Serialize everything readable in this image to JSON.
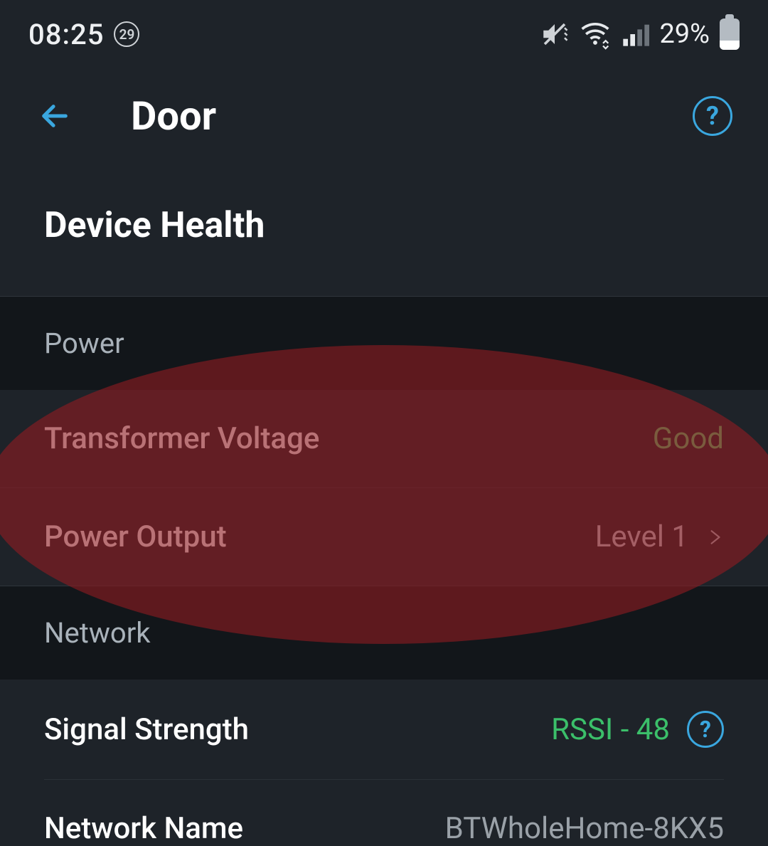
{
  "status_bar": {
    "time": "08:25",
    "notification_count": "29",
    "battery_pct": "29%",
    "battery_level_pct": 29
  },
  "app_bar": {
    "title": "Door",
    "help_icon": "?"
  },
  "page": {
    "heading": "Device Health"
  },
  "sections": {
    "power": {
      "header": "Power",
      "rows": {
        "transformer_voltage": {
          "label": "Transformer Voltage",
          "value": "Good"
        },
        "power_output": {
          "label": "Power Output",
          "value": "Level 1"
        }
      }
    },
    "network": {
      "header": "Network",
      "rows": {
        "signal_strength": {
          "label": "Signal Strength",
          "value": "RSSI - 48"
        },
        "network_name": {
          "label": "Network Name",
          "value": "BTWholeHome-8KX5"
        }
      }
    }
  },
  "highlight_color": "#8e1c22",
  "colors": {
    "accent": "#3aa7df",
    "good": "#59c66c"
  }
}
